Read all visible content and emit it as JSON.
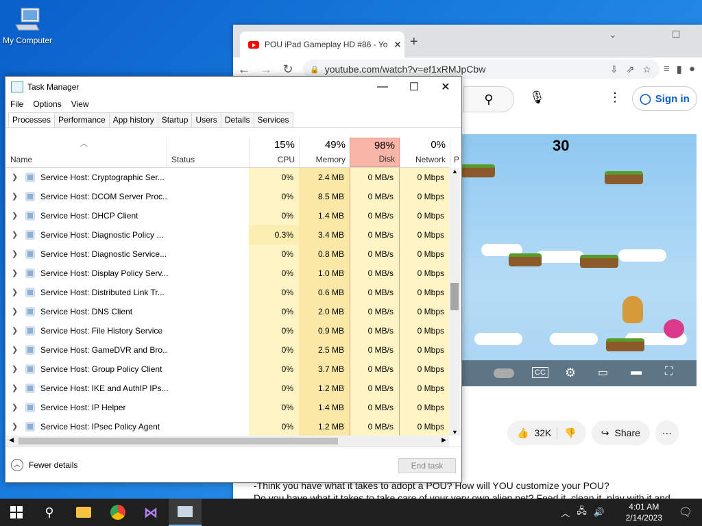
{
  "desktop": {
    "my_computer_label": "My Computer"
  },
  "browser": {
    "tab_title": "POU iPad Gameplay HD #86 - Yo",
    "url": "youtube.com/watch?v=ef1xRMJpCbw",
    "signin_label": "Sign in",
    "like_count": "32K",
    "share_label": "Share",
    "description_line1": "-Think you have what it takes to adopt a POU? How will YOU customize your POU?",
    "description_line2": "Do you have what it takes to take care of your very own alien pet? Feed it, clean it, play with it and"
  },
  "taskmanager": {
    "title": "Task Manager",
    "menu": [
      "File",
      "Options",
      "View"
    ],
    "tabs": [
      "Processes",
      "Performance",
      "App history",
      "Startup",
      "Users",
      "Details",
      "Services"
    ],
    "headers": {
      "name": "Name",
      "status": "Status",
      "cpu_pct": "15%",
      "cpu": "CPU",
      "mem_pct": "49%",
      "mem": "Memory",
      "disk_pct": "98%",
      "disk": "Disk",
      "net_pct": "0%",
      "net": "Network",
      "more": "P"
    },
    "rows": [
      {
        "name": "Service Host: Cryptographic Ser...",
        "cpu": "0%",
        "mem": "2.4 MB",
        "disk": "0 MB/s",
        "net": "0 Mbps"
      },
      {
        "name": "Service Host: DCOM Server Proc...",
        "cpu": "0%",
        "mem": "8.5 MB",
        "disk": "0 MB/s",
        "net": "0 Mbps"
      },
      {
        "name": "Service Host: DHCP Client",
        "cpu": "0%",
        "mem": "1.4 MB",
        "disk": "0 MB/s",
        "net": "0 Mbps"
      },
      {
        "name": "Service Host: Diagnostic Policy ...",
        "cpu": "0.3%",
        "mem": "3.4 MB",
        "disk": "0 MB/s",
        "net": "0 Mbps"
      },
      {
        "name": "Service Host: Diagnostic Service...",
        "cpu": "0%",
        "mem": "0.8 MB",
        "disk": "0 MB/s",
        "net": "0 Mbps"
      },
      {
        "name": "Service Host: Display Policy Serv...",
        "cpu": "0%",
        "mem": "1.0 MB",
        "disk": "0 MB/s",
        "net": "0 Mbps"
      },
      {
        "name": "Service Host: Distributed Link Tr...",
        "cpu": "0%",
        "mem": "0.6 MB",
        "disk": "0 MB/s",
        "net": "0 Mbps"
      },
      {
        "name": "Service Host: DNS Client",
        "cpu": "0%",
        "mem": "2.0 MB",
        "disk": "0 MB/s",
        "net": "0 Mbps"
      },
      {
        "name": "Service Host: File History Service",
        "cpu": "0%",
        "mem": "0.9 MB",
        "disk": "0 MB/s",
        "net": "0 Mbps"
      },
      {
        "name": "Service Host: GameDVR and Bro...",
        "cpu": "0%",
        "mem": "2.5 MB",
        "disk": "0 MB/s",
        "net": "0 Mbps"
      },
      {
        "name": "Service Host: Group Policy Client",
        "cpu": "0%",
        "mem": "3.7 MB",
        "disk": "0 MB/s",
        "net": "0 Mbps"
      },
      {
        "name": "Service Host: IKE and AuthIP IPs...",
        "cpu": "0%",
        "mem": "1.2 MB",
        "disk": "0 MB/s",
        "net": "0 Mbps"
      },
      {
        "name": "Service Host: IP Helper",
        "cpu": "0%",
        "mem": "1.4 MB",
        "disk": "0 MB/s",
        "net": "0 Mbps"
      },
      {
        "name": "Service Host: IPsec Policy Agent",
        "cpu": "0%",
        "mem": "1.2 MB",
        "disk": "0 MB/s",
        "net": "0 Mbps"
      }
    ],
    "fewer_details": "Fewer details",
    "end_task": "End task"
  },
  "taskbar": {
    "time": "4:01 AM",
    "date": "2/14/2023"
  },
  "colors": {
    "disk_header": "#f9b5a8",
    "usage_cell": "#fff4c4",
    "taskbar": "#1f1f1f"
  }
}
